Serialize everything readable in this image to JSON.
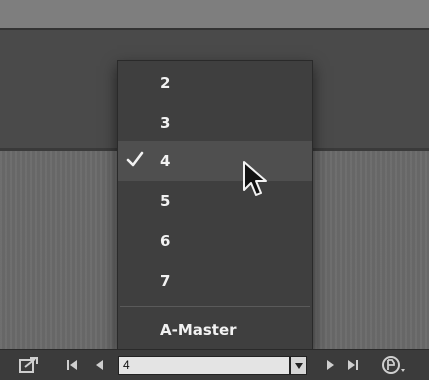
{
  "page_menu": {
    "items": [
      {
        "label": "2",
        "checked": false
      },
      {
        "label": "3",
        "checked": false
      },
      {
        "label": "4",
        "checked": true
      },
      {
        "label": "5",
        "checked": false
      },
      {
        "label": "6",
        "checked": false
      },
      {
        "label": "7",
        "checked": false
      }
    ],
    "master_label": "A-Master"
  },
  "status_bar": {
    "page_field_value": "4",
    "icons": [
      "export-icon",
      "first-page-icon",
      "previous-page-icon",
      "dropdown-arrow-icon",
      "next-page-icon",
      "last-page-icon",
      "page-options-icon"
    ]
  },
  "colors": {
    "menu_bg": "#3f3f3f",
    "menu_highlight": "#4f4f4f",
    "menu_text": "#f2f2f2",
    "status_bar_bg": "#3b3b3b"
  }
}
